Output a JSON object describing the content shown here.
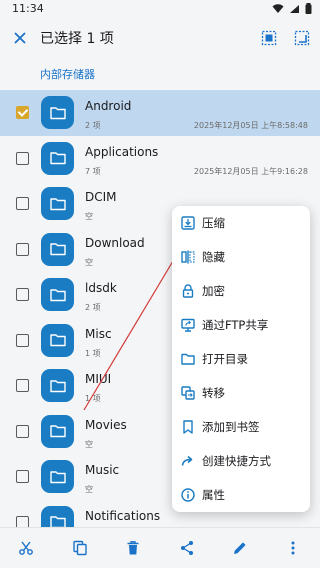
{
  "status_bar": {
    "time": "11:34"
  },
  "header": {
    "title": "已选择 1 项"
  },
  "breadcrumb": {
    "label": "内部存储器"
  },
  "files": [
    {
      "name": "Android",
      "sub": "2 项",
      "date": "2025年12月05日 上午8:58:48",
      "checked": true
    },
    {
      "name": "Applications",
      "sub": "7 项",
      "date": "2025年12月05日 上午9:16:28",
      "checked": false
    },
    {
      "name": "DCIM",
      "sub": "空",
      "date": "",
      "checked": false
    },
    {
      "name": "Download",
      "sub": "空",
      "date": "",
      "checked": false
    },
    {
      "name": "ldsdk",
      "sub": "2 项",
      "date": "",
      "checked": false
    },
    {
      "name": "Misc",
      "sub": "1 项",
      "date": "",
      "checked": false
    },
    {
      "name": "MIUI",
      "sub": "1 项",
      "date": "",
      "checked": false
    },
    {
      "name": "Movies",
      "sub": "空",
      "date": "",
      "checked": false
    },
    {
      "name": "Music",
      "sub": "空",
      "date": "",
      "checked": false
    },
    {
      "name": "Notifications",
      "sub": "",
      "date": "",
      "checked": false
    }
  ],
  "menu": {
    "compress": "压缩",
    "hide": "隐藏",
    "encrypt": "加密",
    "ftp_share": "通过FTP共享",
    "open_directory": "打开目录",
    "transfer": "转移",
    "add_bookmark": "添加到书签",
    "create_shortcut": "创建快捷方式",
    "properties": "属性"
  },
  "colors": {
    "accent": "#1a7cc2",
    "selected_row": "#bfd8ef",
    "checkbox_checked": "#d7a62a",
    "annotation_arrow": "#d33a3a"
  }
}
